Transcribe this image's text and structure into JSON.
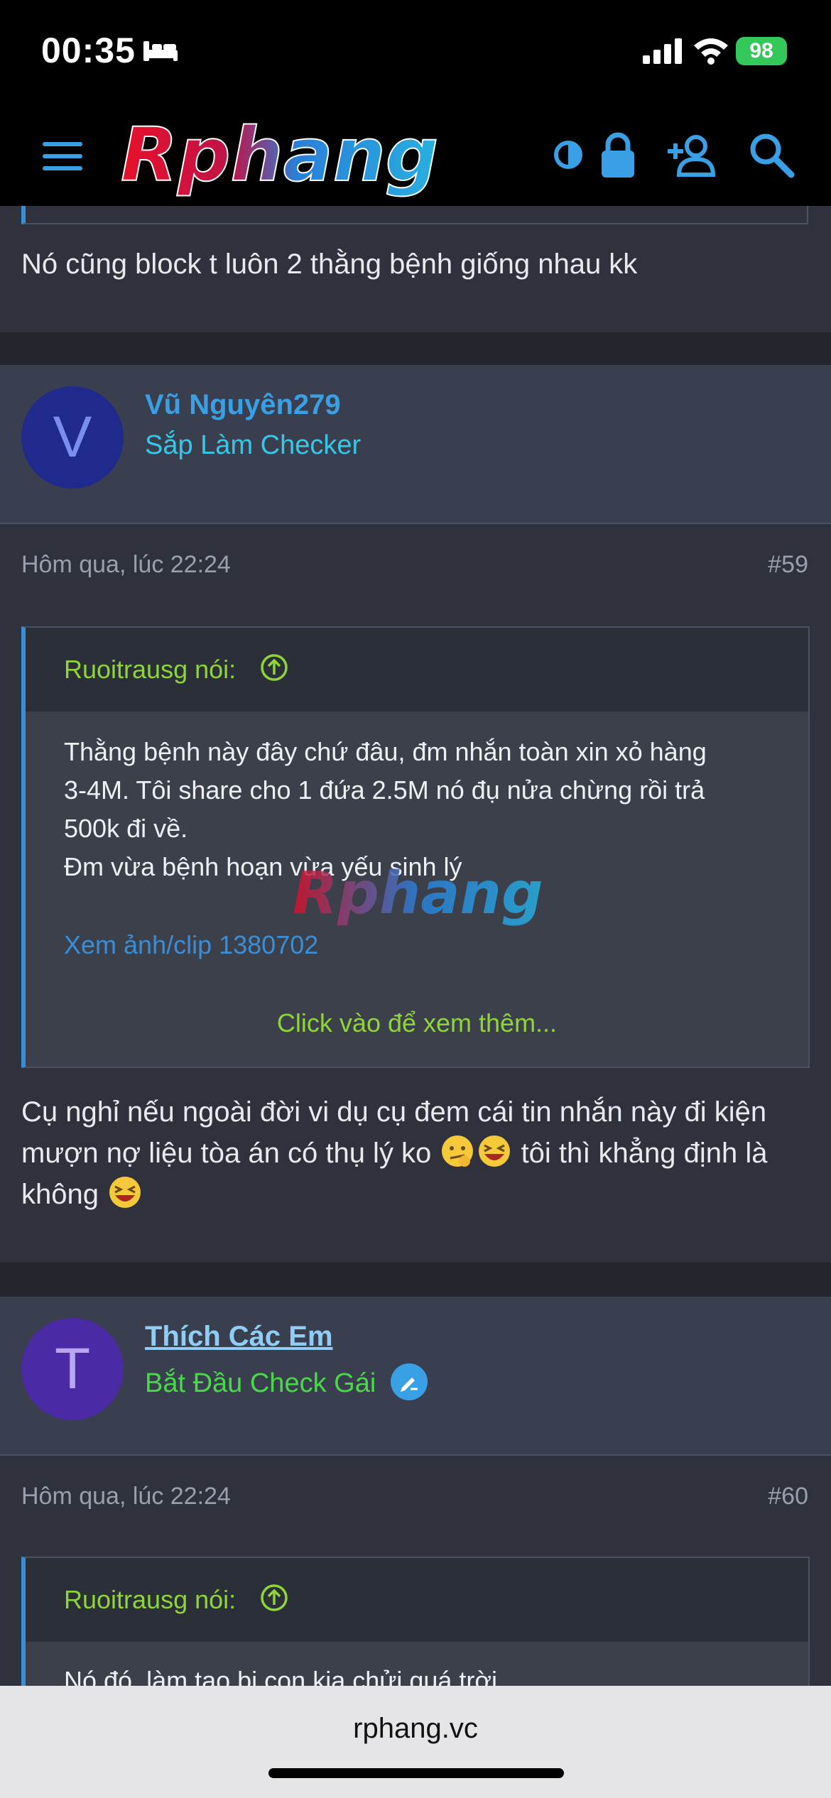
{
  "status_bar": {
    "time": "00:35",
    "battery": "98"
  },
  "header": {
    "logo_text": "Rphang"
  },
  "prev_post": {
    "text": "Nó cũng block t luôn 2 thằng bệnh giống nhau kk"
  },
  "posts": [
    {
      "avatar_letter": "V",
      "avatar_color": "#1f2a8c",
      "username": "Vũ Nguyên279",
      "user_title": "Sắp Làm Checker",
      "date": "Hôm qua, lúc 22:24",
      "number": "#59",
      "quote": {
        "author": "Ruoitrausg nói:",
        "lines": [
          "Thằng bệnh này đây chứ đâu, đm nhắn toàn xin xỏ hàng",
          "3-4M. Tôi share cho 1 đứa 2.5M nó đụ nửa chừng rồi trả",
          "500k đi về.",
          "Đm vừa bệnh hoạn vừa yếu sinh lý"
        ],
        "link": "Xem ảnh/clip 1380702",
        "more": "Click vào để xem thêm..."
      },
      "body_line1": "Cụ nghỉ nếu ngoài đời vi dụ cụ đem cái tin nhắn này đi kiện",
      "body_line2a": "mượn nợ liệu tòa án có thụ lý ko",
      "body_line2b": "tôi thì khẳng định là",
      "body_line3": "không"
    },
    {
      "avatar_letter": "T",
      "avatar_color": "#4b2aa6",
      "username": "Thích Các Em",
      "user_title": "Bắt Đầu Check Gái",
      "date": "Hôm qua, lúc 22:24",
      "number": "#60",
      "quote": {
        "author": "Ruoitrausg nói:",
        "first_line": "Nó đó, làm tao bị con kia chửi quá trời"
      }
    }
  ],
  "browser": {
    "url": "rphang.vc"
  },
  "colors": {
    "link": "#3a8ed8",
    "quote_author": "#8fd43a",
    "title_cyan": "#35c8e8",
    "title_green": "#4ad84a"
  }
}
